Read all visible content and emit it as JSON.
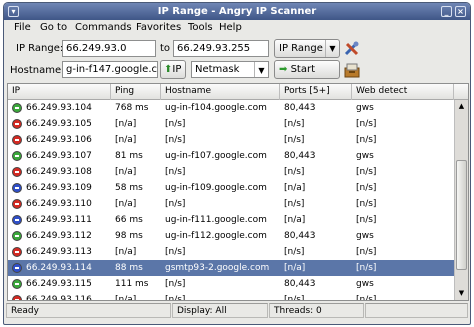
{
  "window": {
    "title": "IP Range - Angry IP Scanner"
  },
  "menu": [
    "File",
    "Go to",
    "Commands",
    "Favorites",
    "Tools",
    "Help"
  ],
  "toolbar": {
    "ip_range_label": "IP Range:",
    "range_start": "66.249.93.0",
    "to_label": "to",
    "range_end": "66.249.93.255",
    "feeder_select": "IP Range",
    "hostname_label": "Hostname:",
    "hostname_value": "g-in-f147.google.com",
    "ip_button_label": "IP",
    "netmask_select": "Netmask",
    "start_button_label": "Start"
  },
  "table": {
    "headers": [
      "IP",
      "Ping",
      "Hostname",
      "Ports [5+]",
      "Web detect"
    ],
    "rows": [
      {
        "status": "green",
        "ip": "66.249.93.104",
        "ping": "768 ms",
        "host": "ug-in-f104.google.com",
        "ports": "80,443",
        "web": "gws"
      },
      {
        "status": "red",
        "ip": "66.249.93.105",
        "ping": "[n/a]",
        "host": "[n/s]",
        "ports": "[n/s]",
        "web": "[n/s]"
      },
      {
        "status": "red",
        "ip": "66.249.93.106",
        "ping": "[n/a]",
        "host": "[n/s]",
        "ports": "[n/s]",
        "web": "[n/s]"
      },
      {
        "status": "green",
        "ip": "66.249.93.107",
        "ping": "81 ms",
        "host": "ug-in-f107.google.com",
        "ports": "80,443",
        "web": "gws"
      },
      {
        "status": "red",
        "ip": "66.249.93.108",
        "ping": "[n/a]",
        "host": "[n/s]",
        "ports": "[n/s]",
        "web": "[n/s]"
      },
      {
        "status": "blue",
        "ip": "66.249.93.109",
        "ping": "58 ms",
        "host": "ug-in-f109.google.com",
        "ports": "[n/a]",
        "web": "[n/s]"
      },
      {
        "status": "red",
        "ip": "66.249.93.110",
        "ping": "[n/a]",
        "host": "[n/s]",
        "ports": "[n/s]",
        "web": "[n/s]"
      },
      {
        "status": "blue",
        "ip": "66.249.93.111",
        "ping": "66 ms",
        "host": "ug-in-f111.google.com",
        "ports": "[n/a]",
        "web": "[n/s]"
      },
      {
        "status": "green",
        "ip": "66.249.93.112",
        "ping": "98 ms",
        "host": "ug-in-f112.google.com",
        "ports": "80,443",
        "web": "gws"
      },
      {
        "status": "red",
        "ip": "66.249.93.113",
        "ping": "[n/a]",
        "host": "[n/s]",
        "ports": "[n/s]",
        "web": "[n/s]"
      },
      {
        "status": "blue",
        "ip": "66.249.93.114",
        "ping": "88 ms",
        "host": "gsmtp93-2.google.com",
        "ports": "[n/a]",
        "web": "[n/s]"
      },
      {
        "status": "green",
        "ip": "66.249.93.115",
        "ping": "111 ms",
        "host": "[n/s]",
        "ports": "80,443",
        "web": "gws"
      },
      {
        "status": "red",
        "ip": "66.249.93.116",
        "ping": "[n/a]",
        "host": "[n/s]",
        "ports": "[n/s]",
        "web": "[n/s]"
      }
    ]
  },
  "colors": {
    "green": "#3aa83a",
    "red": "#d42a22",
    "blue": "#2f4fc8",
    "selection": "#5b76a8"
  },
  "status": {
    "ready": "Ready",
    "display": "Display: All",
    "threads": "Threads: 0"
  }
}
